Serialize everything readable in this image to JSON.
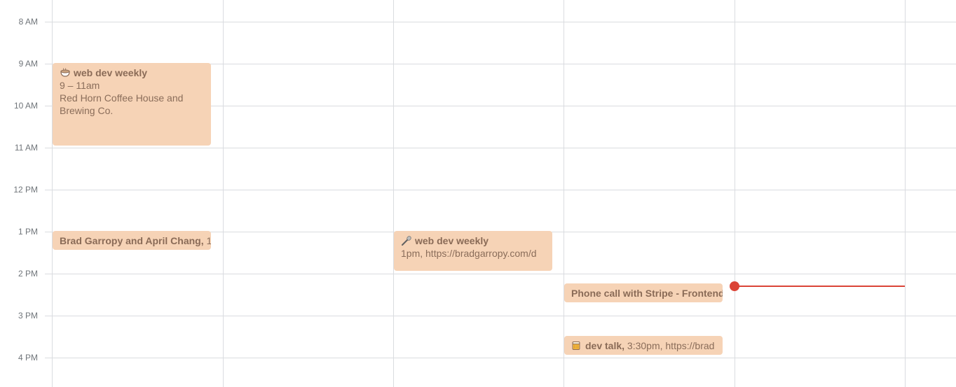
{
  "time_labels": [
    "8 AM",
    "9 AM",
    "10 AM",
    "11 AM",
    "12 PM",
    "1 PM",
    "2 PM",
    "3 PM",
    "4 PM"
  ],
  "events": {
    "web_dev_weekly_1": {
      "icon": "coffee-cup-icon",
      "title": "web dev weekly",
      "time": "9 – 11am",
      "location": "Red Horn Coffee House and Brewing Co."
    },
    "brad_april": {
      "title": "Brad Garropy and April Chang,",
      "detail": " 1"
    },
    "web_dev_weekly_2": {
      "icon": "microphone-icon",
      "title": "web dev weekly",
      "detail": "1pm, https://bradgarropy.com/d"
    },
    "phone_call": {
      "title": "Phone call with Stripe - Frontend"
    },
    "dev_talk": {
      "icon": "beer-mug-icon",
      "title": "dev talk,",
      "detail": " 3:30pm, https://brad"
    }
  },
  "colors": {
    "event_bg": "#f6d3b6",
    "event_text": "#8a6d5a",
    "now_indicator": "#db4437",
    "grid": "#dadce0"
  }
}
